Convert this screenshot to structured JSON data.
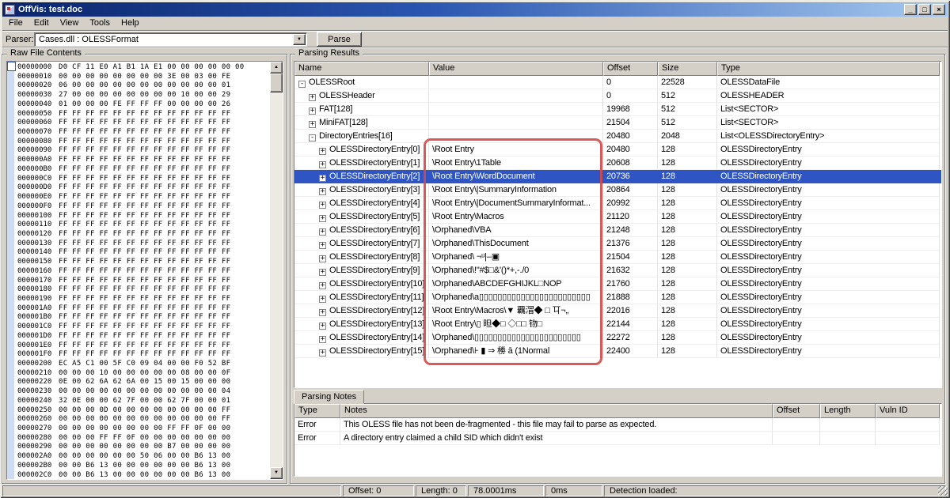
{
  "window": {
    "title": "OffVis: test.doc",
    "controls": {
      "minimize": "_",
      "maximize": "□",
      "close": "×"
    }
  },
  "menu": {
    "items": [
      "File",
      "Edit",
      "View",
      "Tools",
      "Help"
    ]
  },
  "parser_bar": {
    "label": "Parser:",
    "selected_parser": "Cases.dll : OLESSFormat",
    "parse_button": "Parse"
  },
  "icons": {
    "scroll_up": "▲",
    "scroll_down": "▼",
    "dropdown": "▼"
  },
  "raw_file_contents": {
    "group_label": "Raw File Contents",
    "rows": [
      {
        "offset": "00000000",
        "bytes": "D0 CF 11 E0 A1 B1 1A E1 00 00 00 00 00 00"
      },
      {
        "offset": "00000010",
        "bytes": "00 00 00 00 00 00 00 00 3E 00 03 00 FE"
      },
      {
        "offset": "00000020",
        "bytes": "06 00 00 00 00 00 00 00 00 00 00 00 01"
      },
      {
        "offset": "00000030",
        "bytes": "27 00 00 00 00 00 00 00 00 10 00 00 29"
      },
      {
        "offset": "00000040",
        "bytes": "01 00 00 00 FE FF FF FF 00 00 00 00 26"
      },
      {
        "offset": "00000050",
        "bytes": "FF FF FF FF FF FF FF FF FF FF FF FF FF"
      },
      {
        "offset": "00000060",
        "bytes": "FF FF FF FF FF FF FF FF FF FF FF FF FF"
      },
      {
        "offset": "00000070",
        "bytes": "FF FF FF FF FF FF FF FF FF FF FF FF FF"
      },
      {
        "offset": "00000080",
        "bytes": "FF FF FF FF FF FF FF FF FF FF FF FF FF"
      },
      {
        "offset": "00000090",
        "bytes": "FF FF FF FF FF FF FF FF FF FF FF FF FF"
      },
      {
        "offset": "000000A0",
        "bytes": "FF FF FF FF FF FF FF FF FF FF FF FF FF"
      },
      {
        "offset": "000000B0",
        "bytes": "FF FF FF FF FF FF FF FF FF FF FF FF FF"
      },
      {
        "offset": "000000C0",
        "bytes": "FF FF FF FF FF FF FF FF FF FF FF FF FF"
      },
      {
        "offset": "000000D0",
        "bytes": "FF FF FF FF FF FF FF FF FF FF FF FF FF"
      },
      {
        "offset": "000000E0",
        "bytes": "FF FF FF FF FF FF FF FF FF FF FF FF FF"
      },
      {
        "offset": "000000F0",
        "bytes": "FF FF FF FF FF FF FF FF FF FF FF FF FF"
      },
      {
        "offset": "00000100",
        "bytes": "FF FF FF FF FF FF FF FF FF FF FF FF FF"
      },
      {
        "offset": "00000110",
        "bytes": "FF FF FF FF FF FF FF FF FF FF FF FF FF"
      },
      {
        "offset": "00000120",
        "bytes": "FF FF FF FF FF FF FF FF FF FF FF FF FF"
      },
      {
        "offset": "00000130",
        "bytes": "FF FF FF FF FF FF FF FF FF FF FF FF FF"
      },
      {
        "offset": "00000140",
        "bytes": "FF FF FF FF FF FF FF FF FF FF FF FF FF"
      },
      {
        "offset": "00000150",
        "bytes": "FF FF FF FF FF FF FF FF FF FF FF FF FF"
      },
      {
        "offset": "00000160",
        "bytes": "FF FF FF FF FF FF FF FF FF FF FF FF FF"
      },
      {
        "offset": "00000170",
        "bytes": "FF FF FF FF FF FF FF FF FF FF FF FF FF"
      },
      {
        "offset": "00000180",
        "bytes": "FF FF FF FF FF FF FF FF FF FF FF FF FF"
      },
      {
        "offset": "00000190",
        "bytes": "FF FF FF FF FF FF FF FF FF FF FF FF FF"
      },
      {
        "offset": "000001A0",
        "bytes": "FF FF FF FF FF FF FF FF FF FF FF FF FF"
      },
      {
        "offset": "000001B0",
        "bytes": "FF FF FF FF FF FF FF FF FF FF FF FF FF"
      },
      {
        "offset": "000001C0",
        "bytes": "FF FF FF FF FF FF FF FF FF FF FF FF FF"
      },
      {
        "offset": "000001D0",
        "bytes": "FF FF FF FF FF FF FF FF FF FF FF FF FF"
      },
      {
        "offset": "000001E0",
        "bytes": "FF FF FF FF FF FF FF FF FF FF FF FF FF"
      },
      {
        "offset": "000001F0",
        "bytes": "FF FF FF FF FF FF FF FF FF FF FF FF FF"
      },
      {
        "offset": "00000200",
        "bytes": "EC A5 C1 00 5F C0 09 04 00 00 F0 52 BF"
      },
      {
        "offset": "00000210",
        "bytes": "00 00 00 10 00 00 00 00 00 08 00 00 0F"
      },
      {
        "offset": "00000220",
        "bytes": "0E 00 62 6A 62 6A 00 15 00 15 00 00 00"
      },
      {
        "offset": "00000230",
        "bytes": "00 00 00 00 00 00 00 00 00 00 00 00 04"
      },
      {
        "offset": "00000240",
        "bytes": "32 0E 00 00 62 7F 00 00 62 7F 00 00 01"
      },
      {
        "offset": "00000250",
        "bytes": "00 00 00 0D 00 00 00 00 00 00 00 00 FF"
      },
      {
        "offset": "00000260",
        "bytes": "00 00 00 00 00 00 00 00 00 00 00 00 FF"
      },
      {
        "offset": "00000270",
        "bytes": "00 00 00 00 00 00 00 00 FF FF 0F 00 00"
      },
      {
        "offset": "00000280",
        "bytes": "00 00 00 FF FF 0F 00 00 00 00 00 00 00"
      },
      {
        "offset": "00000290",
        "bytes": "00 00 00 00 00 00 00 00 B7 00 00 00 00"
      },
      {
        "offset": "000002A0",
        "bytes": "00 00 00 00 00 00 50 06 00 00 B6 13 00"
      },
      {
        "offset": "000002B0",
        "bytes": "00 00 B6 13 00 00 00 00 00 00 B6 13 00"
      },
      {
        "offset": "000002C0",
        "bytes": "00 00 B6 13 00 00 00 00 00 00 B6 13 00"
      }
    ]
  },
  "parsing_results": {
    "group_label": "Parsing Results",
    "columns": [
      "Name",
      "Value",
      "Offset",
      "Size",
      "Type"
    ],
    "rows": [
      {
        "name": "OLESSRoot",
        "glyph": "minus",
        "indent": 0,
        "value": "",
        "offset": "0",
        "size": "22528",
        "type": "OLESSDataFile",
        "selected": false
      },
      {
        "name": "OLESSHeader",
        "glyph": "plus",
        "indent": 1,
        "value": "",
        "offset": "0",
        "size": "512",
        "type": "OLESSHEADER",
        "selected": false
      },
      {
        "name": "FAT[128]",
        "glyph": "plus",
        "indent": 1,
        "value": "",
        "offset": "19968",
        "size": "512",
        "type": "List<SECTOR>",
        "selected": false
      },
      {
        "name": "MiniFAT[128]",
        "glyph": "plus",
        "indent": 1,
        "value": "",
        "offset": "21504",
        "size": "512",
        "type": "List<SECTOR>",
        "selected": false
      },
      {
        "name": "DirectoryEntries[16]",
        "glyph": "minus",
        "indent": 1,
        "value": "",
        "offset": "20480",
        "size": "2048",
        "type": "List<OLESSDirectoryEntry>",
        "selected": false
      },
      {
        "name": "OLESSDirectoryEntry[0]",
        "glyph": "plus",
        "indent": 2,
        "value": "\\Root Entry",
        "offset": "20480",
        "size": "128",
        "type": "OLESSDirectoryEntry",
        "selected": false
      },
      {
        "name": "OLESSDirectoryEntry[1]",
        "glyph": "plus",
        "indent": 2,
        "value": "\\Root Entry\\1Table",
        "offset": "20608",
        "size": "128",
        "type": "OLESSDirectoryEntry",
        "selected": false
      },
      {
        "name": "OLESSDirectoryEntry[2]",
        "glyph": "plus",
        "indent": 2,
        "value": "\\Root Entry\\WordDocument",
        "offset": "20736",
        "size": "128",
        "type": "OLESSDirectoryEntry",
        "selected": true
      },
      {
        "name": "OLESSDirectoryEntry[3]",
        "glyph": "plus",
        "indent": 2,
        "value": "\\Root Entry\\|SummaryInformation",
        "offset": "20864",
        "size": "128",
        "type": "OLESSDirectoryEntry",
        "selected": false
      },
      {
        "name": "OLESSDirectoryEntry[4]",
        "glyph": "plus",
        "indent": 2,
        "value": "\\Root Entry\\|DocumentSummaryInformat...",
        "offset": "20992",
        "size": "128",
        "type": "OLESSDirectoryEntry",
        "selected": false
      },
      {
        "name": "OLESSDirectoryEntry[5]",
        "glyph": "plus",
        "indent": 2,
        "value": "\\Root Entry\\Macros",
        "offset": "21120",
        "size": "128",
        "type": "OLESSDirectoryEntry",
        "selected": false
      },
      {
        "name": "OLESSDirectoryEntry[6]",
        "glyph": "plus",
        "indent": 2,
        "value": "\\Orphaned\\VBA",
        "offset": "21248",
        "size": "128",
        "type": "OLESSDirectoryEntry",
        "selected": false
      },
      {
        "name": "OLESSDirectoryEntry[7]",
        "glyph": "plus",
        "indent": 2,
        "value": "\\Orphaned\\ThisDocument",
        "offset": "21376",
        "size": "128",
        "type": "OLESSDirectoryEntry",
        "selected": false
      },
      {
        "name": "OLESSDirectoryEntry[8]",
        "glyph": "plus",
        "indent": 2,
        "value": "\\Orphaned\\ ¬ᵘ|–▣",
        "offset": "21504",
        "size": "128",
        "type": "OLESSDirectoryEntry",
        "selected": false
      },
      {
        "name": "OLESSDirectoryEntry[9]",
        "glyph": "plus",
        "indent": 2,
        "value": "\\Orphaned\\!\"#$□&'()*+,-./0",
        "offset": "21632",
        "size": "128",
        "type": "OLESSDirectoryEntry",
        "selected": false
      },
      {
        "name": "OLESSDirectoryEntry[10]",
        "glyph": "plus",
        "indent": 2,
        "value": "\\Orphaned\\ABCDEFGHIJKL□NOP",
        "offset": "21760",
        "size": "128",
        "type": "OLESSDirectoryEntry",
        "selected": false
      },
      {
        "name": "OLESSDirectoryEntry[11]",
        "glyph": "plus",
        "indent": 2,
        "value": "\\Orphaned\\a▯▯▯▯▯▯▯▯▯▯▯▯▯▯▯▯▯▯▯▯▯▯▯▯",
        "offset": "21888",
        "size": "128",
        "type": "OLESSDirectoryEntry",
        "selected": false
      },
      {
        "name": "OLESSDirectoryEntry[12]",
        "glyph": "plus",
        "indent": 2,
        "value": "\\Root Entry\\Macros\\▼  覊㴘◆ □ 㔿¬„",
        "offset": "22016",
        "size": "128",
        "type": "OLESSDirectoryEntry",
        "selected": false
      },
      {
        "name": "OLESSDirectoryEntry[13]",
        "glyph": "plus",
        "indent": 2,
        "value": "\\Root Entry\\▯ 㫜◆□  ◇□□ 䥼□",
        "offset": "22144",
        "size": "128",
        "type": "OLESSDirectoryEntry",
        "selected": false
      },
      {
        "name": "OLESSDirectoryEntry[14]",
        "glyph": "plus",
        "indent": 2,
        "value": "\\Orphaned\\▯▯▯▯▯▯▯▯▯▯▯▯▯▯▯▯▯▯▯▯▯▯▯",
        "offset": "22272",
        "size": "128",
        "type": "OLESSDirectoryEntry",
        "selected": false
      },
      {
        "name": "OLESSDirectoryEntry[15]",
        "glyph": "plus",
        "indent": 2,
        "value": "\\Orphaned\\⊦ ▮ ⇒ 椦 ā (1Normal",
        "offset": "22400",
        "size": "128",
        "type": "OLESSDirectoryEntry",
        "selected": false
      }
    ]
  },
  "parsing_notes": {
    "tab_label": "Parsing Notes",
    "columns": [
      "Type",
      "Notes",
      "Offset",
      "Length",
      "Vuln ID"
    ],
    "rows": [
      {
        "type": "Error",
        "notes": "This OLESS file has not been de-fragmented - this file may fail to parse as expected.",
        "offset": "",
        "length": "",
        "vuln_id": ""
      },
      {
        "type": "Error",
        "notes": "A directory entry claimed a child SID which didn't exist",
        "offset": "",
        "length": "",
        "vuln_id": ""
      }
    ]
  },
  "status_bar": {
    "segments": [
      "",
      "Offset: 0",
      "Length: 0",
      "78.0001ms",
      "0ms",
      "Detection loaded:"
    ]
  },
  "colors": {
    "window_chrome": "#d4d0c8",
    "titlebar_left": "#0a246a",
    "titlebar_right": "#a6caf0",
    "selection": "#2e55c3",
    "annotation": "#d54848"
  }
}
